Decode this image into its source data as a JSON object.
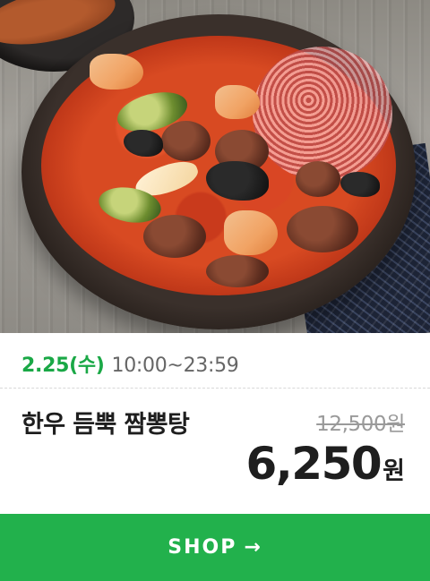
{
  "product": {
    "image_alt_icon": "food-photo",
    "date": "2.25(수)",
    "time": "10:00~23:59",
    "title": "한우 듬뿍 짬뽕탕",
    "original_price": "12,500원",
    "sale_price": "6,250",
    "sale_currency": "원"
  },
  "cta": {
    "label": "SHOP",
    "arrow": "→",
    "color": "#22b14c"
  },
  "colors": {
    "date": "#1aa846",
    "title": "#1e1e1e",
    "strike": "#9a9a9a"
  }
}
